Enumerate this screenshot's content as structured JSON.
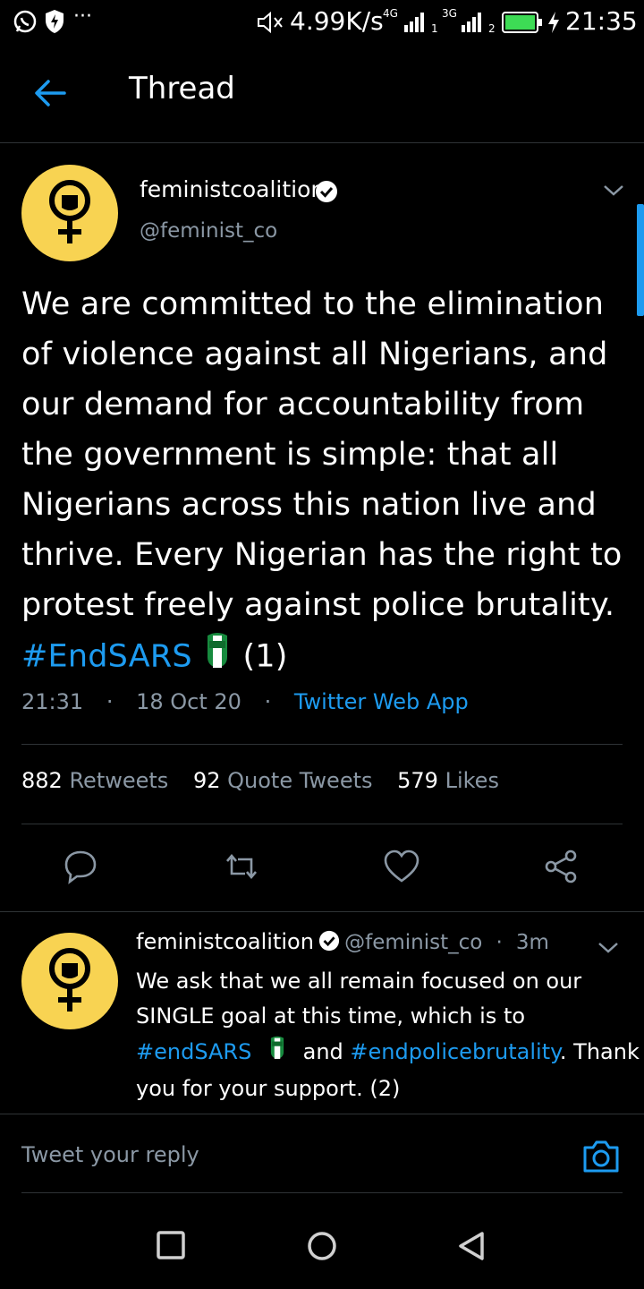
{
  "status_bar": {
    "net_speed": "4.99K/s",
    "net_type_1": "4G",
    "sim_1": "1",
    "net_type_2": "3G",
    "sim_2": "2",
    "time": "21:35",
    "icons": [
      "whatsapp-icon",
      "shield-icon",
      "more-dots-icon",
      "mute-icon",
      "signal-icon",
      "battery-icon",
      "charging-icon"
    ]
  },
  "header": {
    "title": "Thread"
  },
  "main_tweet": {
    "display_name": "feministcoalition",
    "handle": "@feminist_co",
    "text_before": "We are committed to the elimination of violence against all Nigerians, and our demand for accountability from the government is simple: that all Nigerians across this nation live and thrive. Every Nigerian has the right to protest freely against police brutality.",
    "hashtag": "#EndSARS",
    "text_after": "(1)",
    "time": "21:31",
    "date": "18 Oct 20",
    "source": "Twitter Web App",
    "retweets_count": "882",
    "retweets_label": "Retweets",
    "quotes_count": "92",
    "quotes_label": "Quote Tweets",
    "likes_count": "579",
    "likes_label": "Likes"
  },
  "reply_tweet": {
    "display_name": "feministcoalition",
    "handle": "@feminist_co",
    "age": "3m",
    "line1": "We ask that we all remain focused on our",
    "line2": "SINGLE goal at this time, which is to",
    "hashtag1": "#endSARS",
    "and_word": "and",
    "hashtag2": "#endpolicebrutality",
    "line3_tail": ". Thank",
    "line4": "you for your support. (2)"
  },
  "reply_bar": {
    "placeholder": "Tweet your reply"
  },
  "colors": {
    "accent": "#1d9bf0",
    "avatar_bg": "#f8d352",
    "muted": "#8b98a5",
    "divider": "#2f3336"
  }
}
